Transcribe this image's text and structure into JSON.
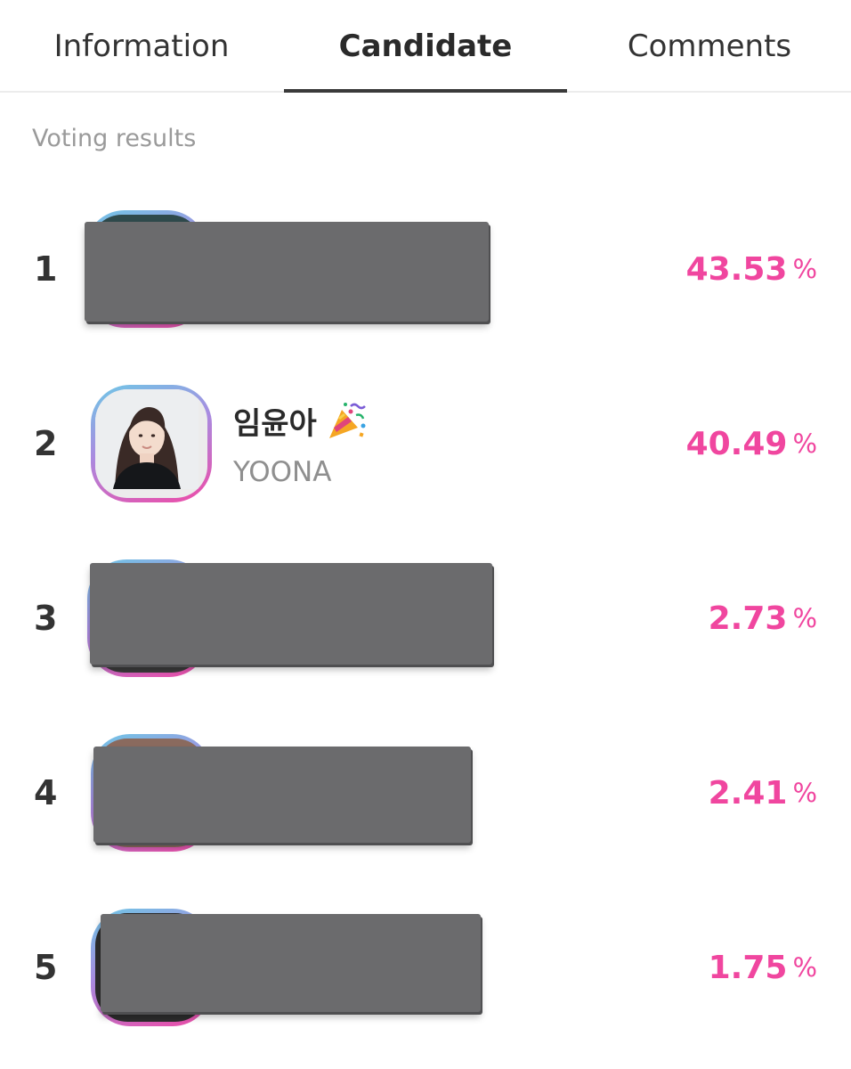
{
  "tabs": {
    "information": "Information",
    "candidate": "Candidate",
    "comments": "Comments",
    "active": "Candidate"
  },
  "section_label": "Voting results",
  "accent_color": "#f0469f",
  "candidates": [
    {
      "rank": "1",
      "percent": "43.53",
      "unit": "%",
      "name": "",
      "subname": "",
      "redacted": true
    },
    {
      "rank": "2",
      "percent": "40.49",
      "unit": "%",
      "name": "임윤아",
      "subname": "YOONA",
      "redacted": false,
      "badge_icon": "party-popper-icon"
    },
    {
      "rank": "3",
      "percent": "2.73",
      "unit": "%",
      "name": "",
      "subname": "",
      "redacted": true
    },
    {
      "rank": "4",
      "percent": "2.41",
      "unit": "%",
      "name": "",
      "subname": "",
      "redacted": true
    },
    {
      "rank": "5",
      "percent": "1.75",
      "unit": "%",
      "name": "",
      "subname": "",
      "redacted": true
    }
  ]
}
